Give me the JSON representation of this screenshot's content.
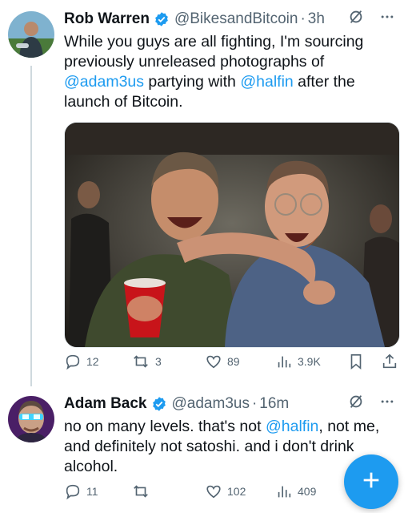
{
  "tweets": [
    {
      "author": "Rob Warren",
      "handle": "@BikesandBitcoin",
      "separator": "·",
      "time": "3h",
      "text_segments": [
        {
          "text": "While you guys are all fighting, I'm sourcing previously unreleased photographs of ",
          "mention": false
        },
        {
          "text": "@adam3us",
          "mention": true
        },
        {
          "text": " partying with ",
          "mention": false
        },
        {
          "text": "@halfin",
          "mention": true
        },
        {
          "text": " after the launch of Bitcoin.",
          "mention": false
        }
      ],
      "stats": {
        "replies": "12",
        "reposts": "3",
        "likes": "89",
        "views": "3.9K"
      }
    },
    {
      "author": "Adam Back",
      "handle": "@adam3us",
      "separator": "·",
      "time": "16m",
      "text_segments": [
        {
          "text": "no on many levels. that's not ",
          "mention": false
        },
        {
          "text": "@halfin",
          "mention": true
        },
        {
          "text": ", not me, and definitely not satoshi. and i don't drink alcohol.",
          "mention": false
        }
      ],
      "stats": {
        "replies": "11",
        "reposts": "",
        "likes": "102",
        "views": "409"
      }
    }
  ],
  "icons": [
    "verified-badge-icon",
    "grok-icon",
    "more-icon",
    "reply-icon",
    "repost-icon",
    "like-icon",
    "views-icon",
    "bookmark-icon",
    "share-icon",
    "plus-icon"
  ],
  "colors": {
    "accent": "#1d9bf0",
    "text": "#0f1419",
    "muted": "#536471",
    "thread_line": "#cfd9de"
  }
}
